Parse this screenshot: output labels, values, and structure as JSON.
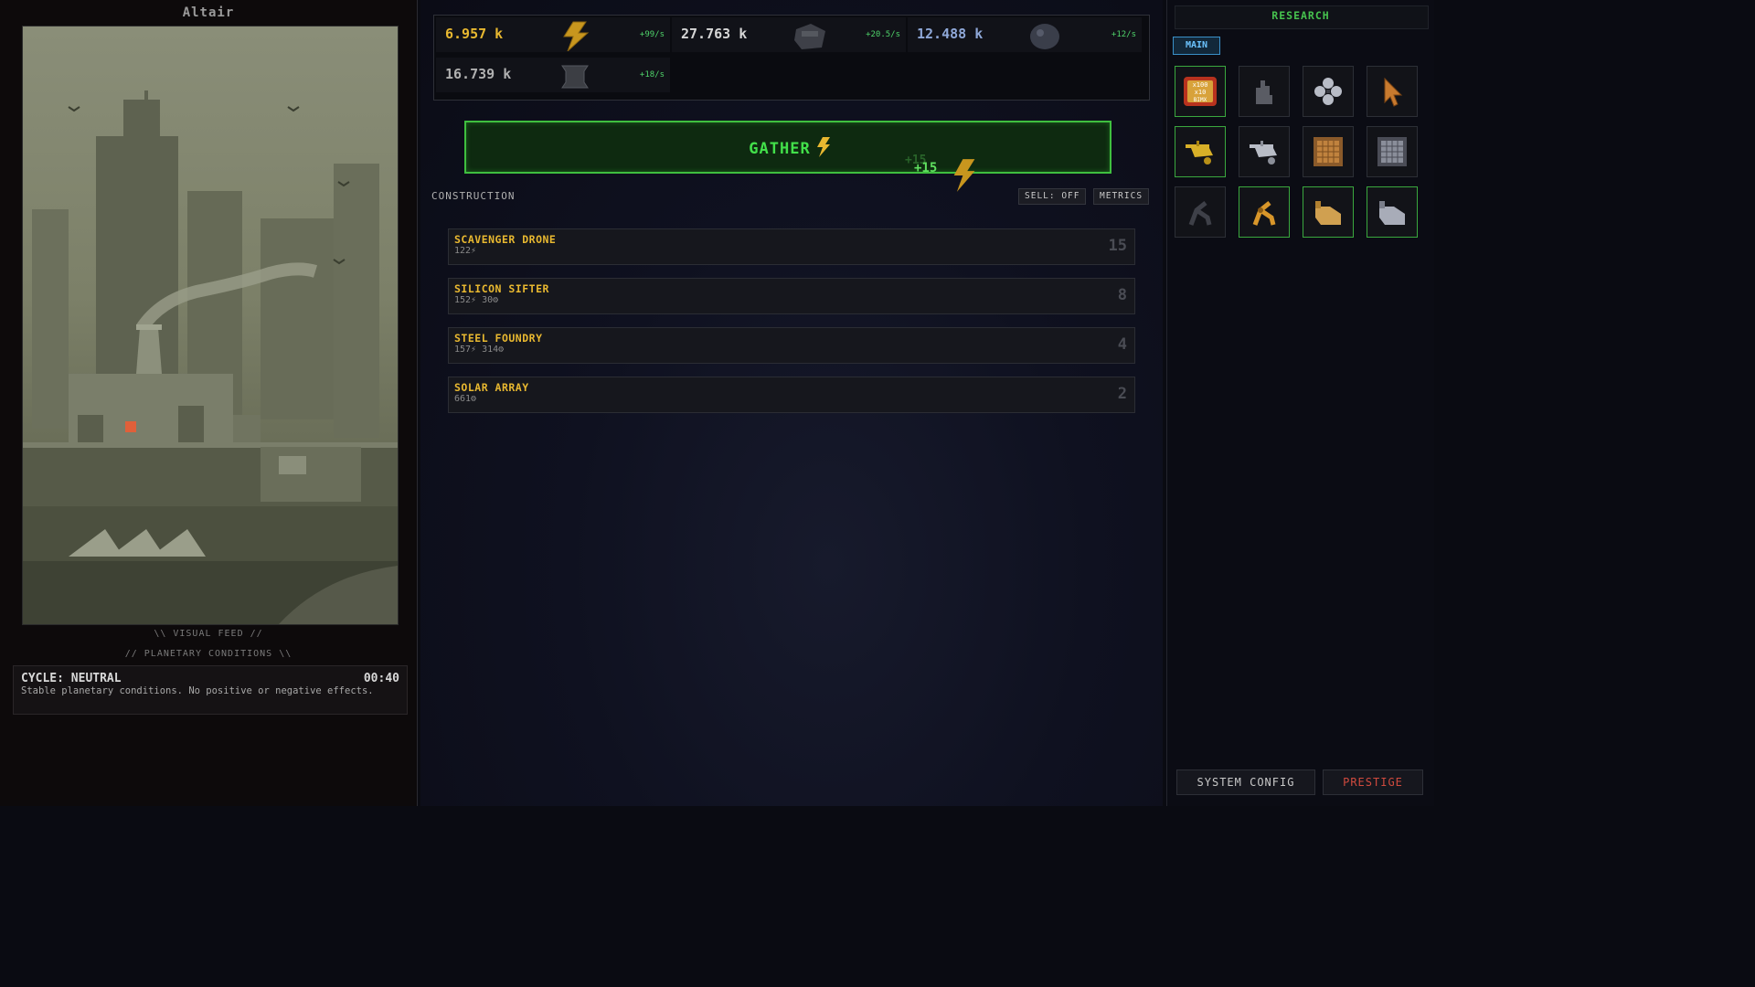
{
  "planet": {
    "name": "Altair"
  },
  "feed": {
    "caption": "\\\\ VISUAL FEED //"
  },
  "conditions": {
    "caption": "// PLANETARY CONDITIONS \\\\",
    "cycle_title": "CYCLE: NEUTRAL",
    "timer": "00:40",
    "description": "Stable planetary conditions. No positive or negative effects."
  },
  "resources": [
    {
      "value": "6.957 k",
      "rate": "+99/s",
      "icon": "energy-icon",
      "color": "#e8b830"
    },
    {
      "value": "27.763 k",
      "rate": "+20.5/s",
      "icon": "scrap-icon",
      "color": "#d6d6d6"
    },
    {
      "value": "12.488 k",
      "rate": "+12/s",
      "icon": "silicon-icon",
      "color": "#8fa8d8"
    },
    {
      "value": "16.739 k",
      "rate": "+18/s",
      "icon": "steel-icon",
      "color": "#b0b0b0"
    }
  ],
  "gather": {
    "label": "GATHER",
    "floating_text": "+15",
    "floating_text_faded": "+15"
  },
  "construction": {
    "title": "CONSTRUCTION",
    "sell_label": "SELL: OFF",
    "metrics_label": "METRICS",
    "buildings": [
      {
        "name": "SCAVENGER DRONE",
        "cost": "122⚡",
        "count": "15"
      },
      {
        "name": "SILICON SIFTER",
        "cost": "152⚡ 30⚙",
        "count": "8"
      },
      {
        "name": "STEEL FOUNDRY",
        "cost": "157⚡ 314⚙",
        "count": "4"
      },
      {
        "name": "SOLAR ARRAY",
        "cost": "661⚙",
        "count": "2"
      }
    ]
  },
  "research": {
    "title": "RESEARCH",
    "tab": "MAIN",
    "badge_text": [
      "x100",
      "x10",
      "BIMX"
    ],
    "items": [
      {
        "icon": "multiplier-badge-icon",
        "active": true
      },
      {
        "icon": "hand-click-icon",
        "active": false
      },
      {
        "icon": "clover-icon",
        "active": false
      },
      {
        "icon": "cursor-icon",
        "active": false
      },
      {
        "icon": "drone-gold-icon",
        "active": true
      },
      {
        "icon": "drone-silver-icon",
        "active": false
      },
      {
        "icon": "grid-panel-bronze-icon",
        "active": false
      },
      {
        "icon": "grid-panel-steel-icon",
        "active": false
      },
      {
        "icon": "arm-dark-icon",
        "active": false
      },
      {
        "icon": "arm-gold-icon",
        "active": true
      },
      {
        "icon": "glove-gold-icon",
        "active": true
      },
      {
        "icon": "glove-silver-icon",
        "active": true
      }
    ]
  },
  "footer": {
    "system_config": "SYSTEM CONFIG",
    "prestige": "PRESTIGE",
    "prestige_color": "#d04a3e"
  }
}
